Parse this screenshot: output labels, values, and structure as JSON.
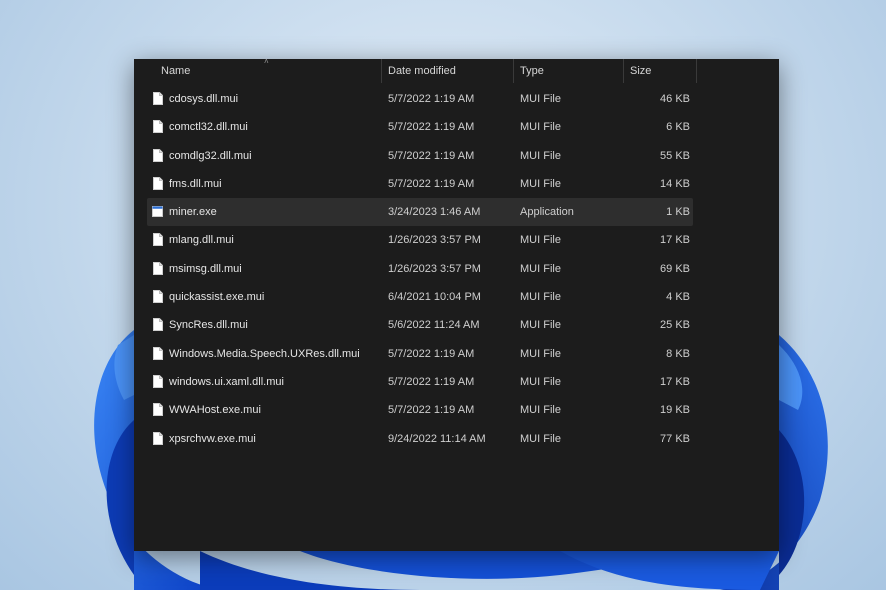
{
  "columns": {
    "name": "Name",
    "date_modified": "Date modified",
    "type": "Type",
    "size": "Size"
  },
  "files": [
    {
      "name": "cdosys.dll.mui",
      "date": "5/7/2022 1:19 AM",
      "type": "MUI File",
      "size": "46 KB",
      "icon": "document-icon"
    },
    {
      "name": "comctl32.dll.mui",
      "date": "5/7/2022 1:19 AM",
      "type": "MUI File",
      "size": "6 KB",
      "icon": "document-icon"
    },
    {
      "name": "comdlg32.dll.mui",
      "date": "5/7/2022 1:19 AM",
      "type": "MUI File",
      "size": "55 KB",
      "icon": "document-icon"
    },
    {
      "name": "fms.dll.mui",
      "date": "5/7/2022 1:19 AM",
      "type": "MUI File",
      "size": "14 KB",
      "icon": "document-icon"
    },
    {
      "name": "miner.exe",
      "date": "3/24/2023 1:46 AM",
      "type": "Application",
      "size": "1 KB",
      "icon": "application-icon",
      "selected": true
    },
    {
      "name": "mlang.dll.mui",
      "date": "1/26/2023 3:57 PM",
      "type": "MUI File",
      "size": "17 KB",
      "icon": "document-icon"
    },
    {
      "name": "msimsg.dll.mui",
      "date": "1/26/2023 3:57 PM",
      "type": "MUI File",
      "size": "69 KB",
      "icon": "document-icon"
    },
    {
      "name": "quickassist.exe.mui",
      "date": "6/4/2021 10:04 PM",
      "type": "MUI File",
      "size": "4 KB",
      "icon": "document-icon"
    },
    {
      "name": "SyncRes.dll.mui",
      "date": "5/6/2022 11:24 AM",
      "type": "MUI File",
      "size": "25 KB",
      "icon": "document-icon"
    },
    {
      "name": "Windows.Media.Speech.UXRes.dll.mui",
      "date": "5/7/2022 1:19 AM",
      "type": "MUI File",
      "size": "8 KB",
      "icon": "document-icon"
    },
    {
      "name": "windows.ui.xaml.dll.mui",
      "date": "5/7/2022 1:19 AM",
      "type": "MUI File",
      "size": "17 KB",
      "icon": "document-icon"
    },
    {
      "name": "WWAHost.exe.mui",
      "date": "5/7/2022 1:19 AM",
      "type": "MUI File",
      "size": "19 KB",
      "icon": "document-icon"
    },
    {
      "name": "xpsrchvw.exe.mui",
      "date": "9/24/2022 11:14 AM",
      "type": "MUI File",
      "size": "77 KB",
      "icon": "document-icon"
    }
  ],
  "colors": {
    "window_bg": "#1c1c1c",
    "selected_row": "#2e2e2e",
    "text": "#e6e6e6",
    "bloom_blue": "#1d5fe0"
  }
}
